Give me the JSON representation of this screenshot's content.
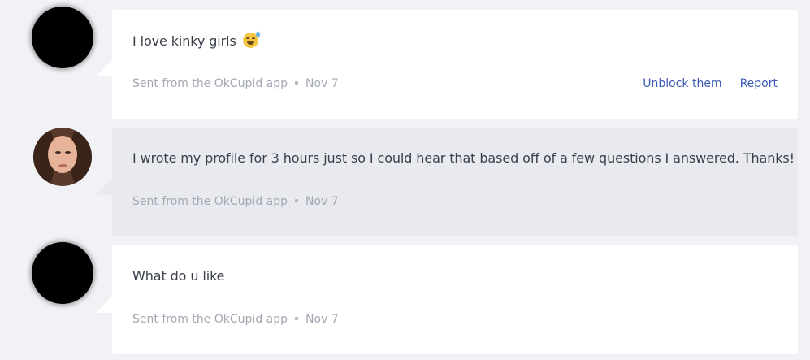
{
  "messages": [
    {
      "sender_avatar": "redacted-black-avatar",
      "text": "I love kinky girls",
      "emoji": "grinning-face-with-sweat-icon",
      "source": "Sent from the OkCupid app",
      "date": "Nov 7",
      "actions": {
        "unblock_label": "Unblock them",
        "report_label": "Report"
      }
    },
    {
      "sender_avatar": "profile-photo",
      "text": "I wrote my profile for 3 hours just so I could hear that based off of a few questions I answered. Thanks!",
      "source": "Sent from the OkCupid app",
      "date": "Nov 7"
    },
    {
      "sender_avatar": "redacted-black-avatar",
      "text": "What do u like",
      "source": "Sent from the OkCupid app",
      "date": "Nov 7"
    }
  ],
  "colors": {
    "page_background": "#f1f2f6",
    "incoming_bubble": "#ffffff",
    "outgoing_bubble": "#e9eaef",
    "link": "#3d5bb5",
    "meta_text": "#a4a8b3",
    "body_text": "#3a3f4b"
  }
}
